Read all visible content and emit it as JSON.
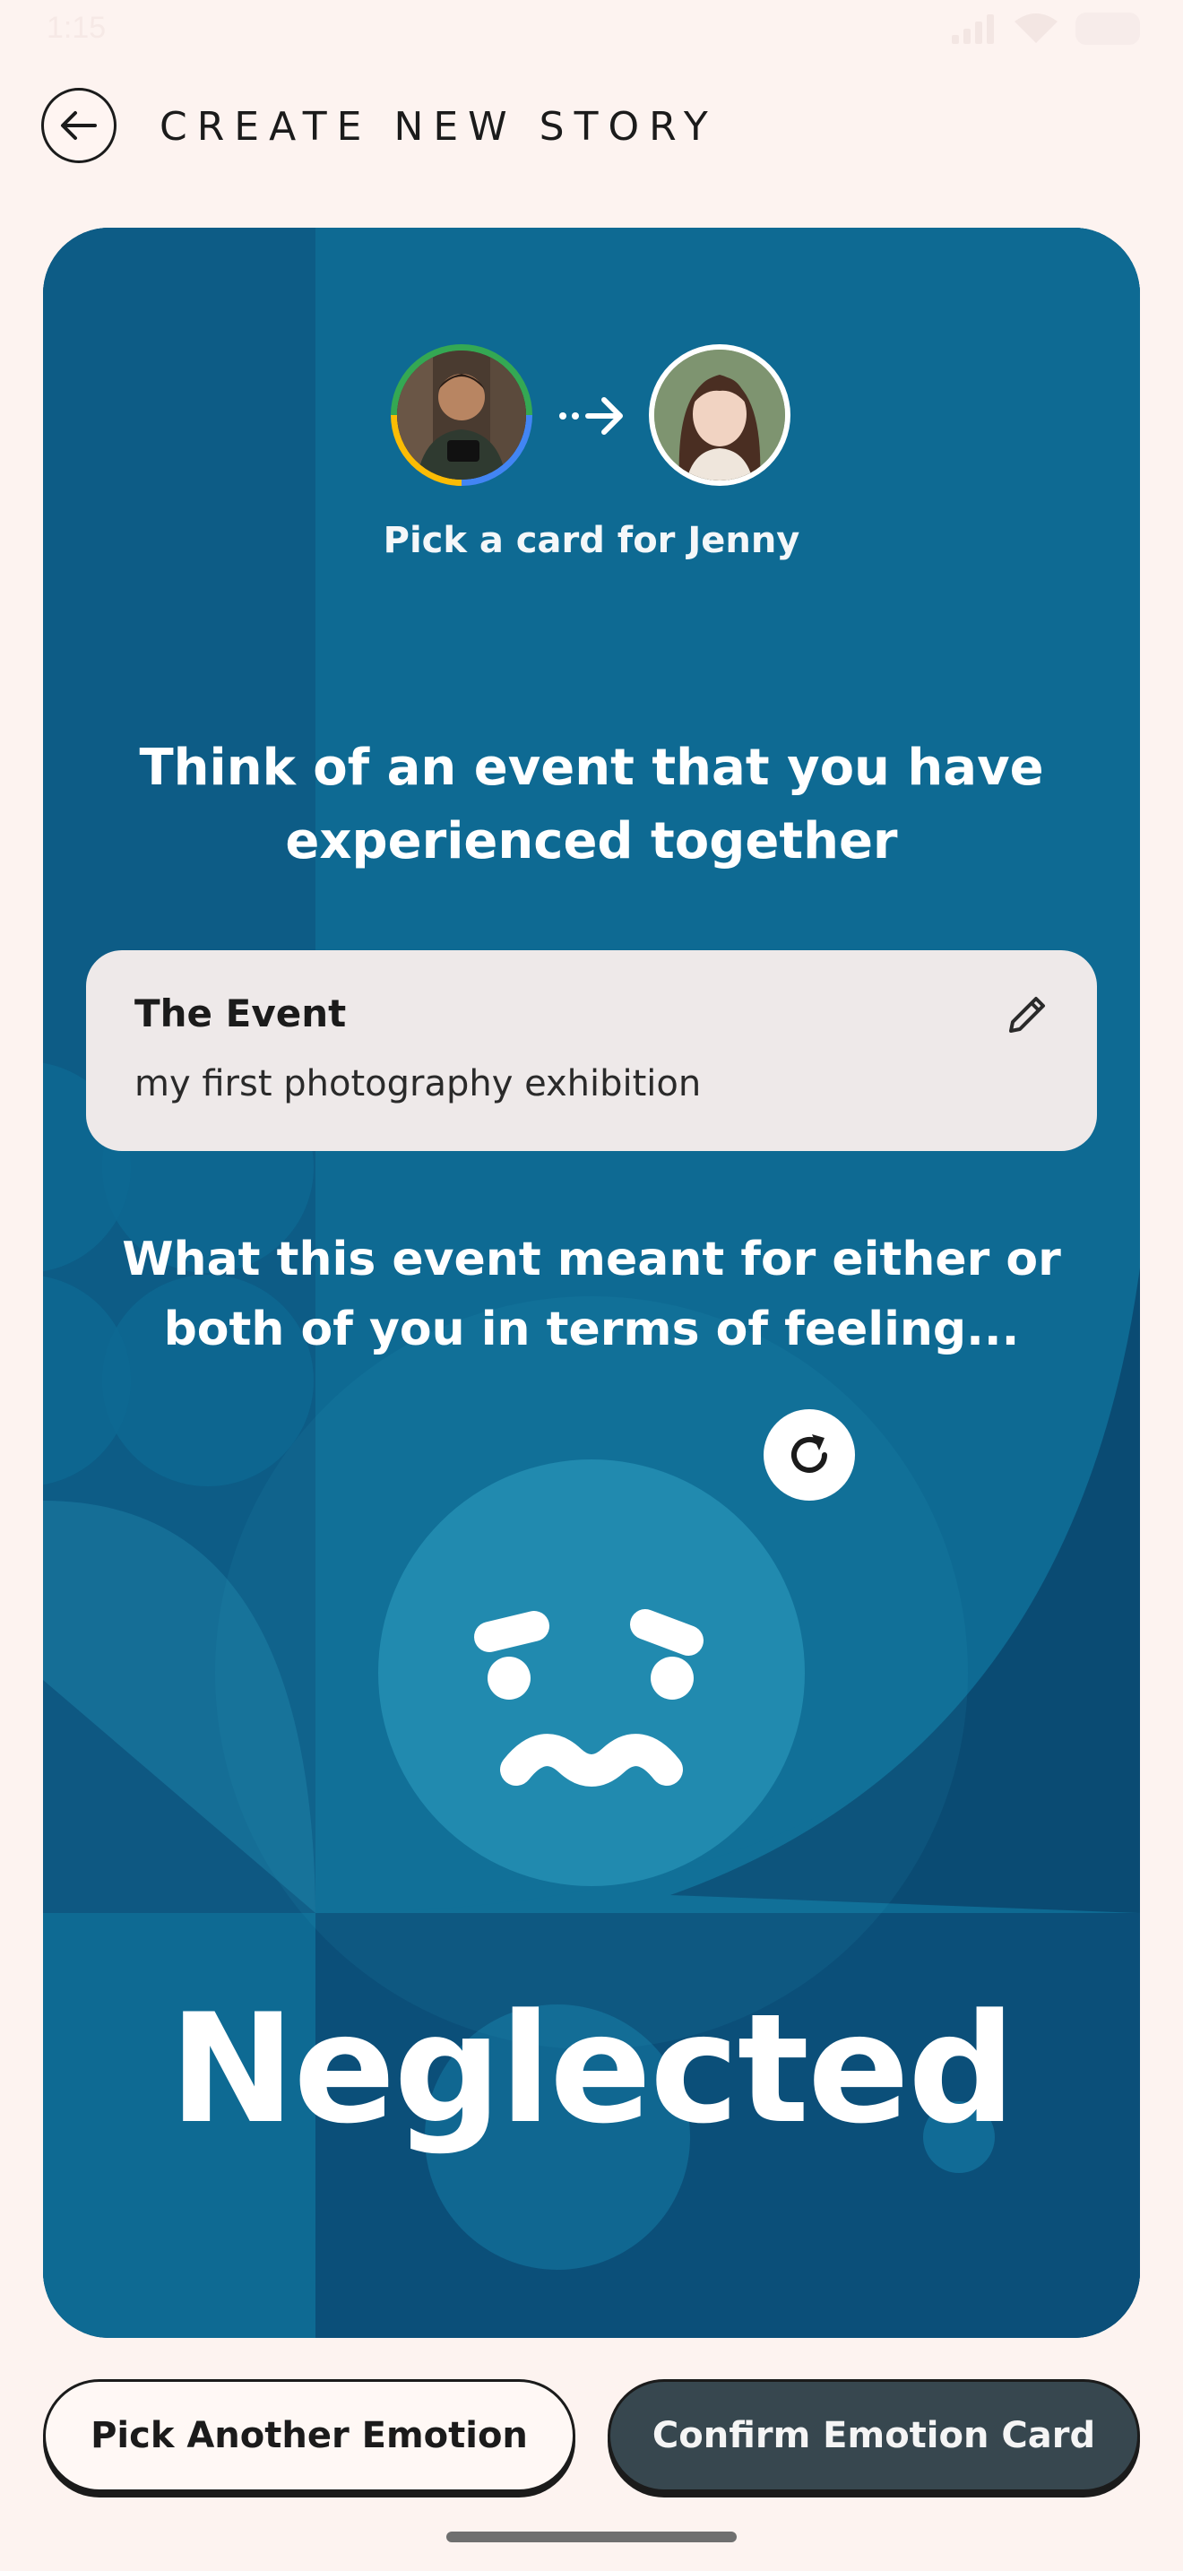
{
  "status_bar": {
    "time": "1:15"
  },
  "header": {
    "title": "CREATE NEW STORY"
  },
  "card": {
    "pick_label": "Pick a card for Jenny",
    "prompt_event": "Think of an event that you have experienced together",
    "event": {
      "title": "The Event",
      "value": "my first photography exhibition"
    },
    "prompt_feeling": "What this event meant for either or both of you in terms of feeling...",
    "emotion": "Neglected"
  },
  "actions": {
    "pick_another": "Pick Another Emotion",
    "confirm": "Confirm Emotion Card"
  },
  "colors": {
    "background": "#fdf3f0",
    "card_dark": "#0b4f79",
    "card_mid": "#0e6a93",
    "face": "#218aaf",
    "primary_button": "#37474f"
  },
  "icons": [
    "back-arrow-icon",
    "dashed-arrow-icon",
    "edit-pencil-icon",
    "refresh-icon",
    "worried-face-icon"
  ]
}
